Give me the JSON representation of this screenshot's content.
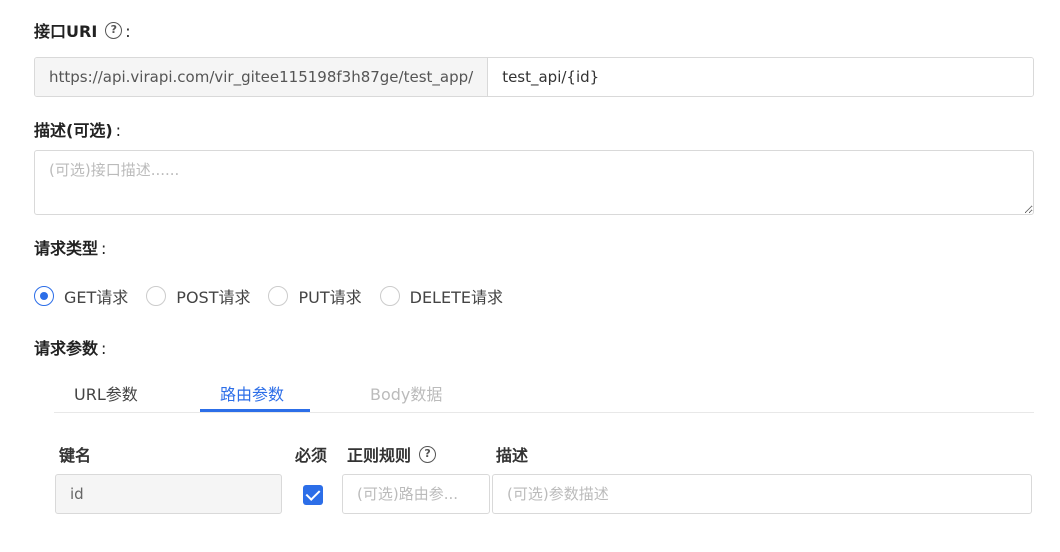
{
  "uri": {
    "label": "接口URI",
    "prefix": "https://api.virapi.com/vir_gitee115198f3h87ge/test_app/",
    "path_value": "test_api/{id}"
  },
  "description": {
    "label": "描述(可选)",
    "placeholder": "(可选)接口描述......"
  },
  "request_type": {
    "label": "请求类型",
    "options": [
      {
        "label": "GET请求",
        "checked": true
      },
      {
        "label": "POST请求",
        "checked": false
      },
      {
        "label": "PUT请求",
        "checked": false
      },
      {
        "label": "DELETE请求",
        "checked": false
      }
    ]
  },
  "request_params": {
    "label": "请求参数",
    "tabs": [
      {
        "label": "URL参数",
        "state": "normal"
      },
      {
        "label": "路由参数",
        "state": "active"
      },
      {
        "label": "Body数据",
        "state": "disabled"
      }
    ],
    "columns": {
      "key": "键名",
      "required": "必须",
      "regex": "正则规则",
      "desc": "描述"
    },
    "rows": [
      {
        "key": "id",
        "required": true,
        "regex_placeholder": "(可选)路由参...",
        "desc_placeholder": "(可选)参数描述"
      }
    ]
  },
  "colon": ":",
  "colors": {
    "accent": "#2c6ee8",
    "border": "#d9d9d9",
    "disabled_text": "#bbbbbb"
  }
}
